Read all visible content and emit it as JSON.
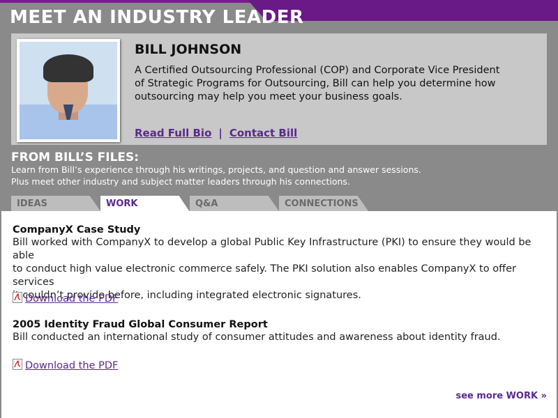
{
  "header": {
    "title": "MEET AN INDUSTRY LEADER"
  },
  "profile": {
    "name": "BILL JOHNSON",
    "bio_lines": [
      "A Certified Outsourcing Professional (COP) and Corporate Vice President",
      "of Strategic Programs for Outsourcing, Bill can help you determine how",
      "outsourcing may help you meet your business goals."
    ],
    "links": {
      "bio": "Read Full Bio",
      "separator": "|",
      "contact": "Contact Bill"
    }
  },
  "files": {
    "title": "FROM BILL’S FILES:",
    "desc_lines": [
      "Learn from Bill’s experience through his writings, projects, and question and answer sessions.",
      "Plus meet other industry and subject matter leaders through his connections."
    ]
  },
  "tabs": [
    {
      "label": "IDEAS",
      "active": false
    },
    {
      "label": "WORK",
      "active": true
    },
    {
      "label": "Q&A",
      "active": false
    },
    {
      "label": "CONNECTIONS",
      "active": false
    }
  ],
  "items": [
    {
      "title": "CompanyX Case Study",
      "body_lines": [
        "Bill worked with CompanyX to develop a global Public Key Infrastructure (PKI) to ensure they would be able",
        "to conduct high value electronic commerce safely. The PKI solution also enables CompanyX to offer services",
        "it couldn’t provide before, including integrated electronic signatures."
      ],
      "download": "Download the PDF "
    },
    {
      "title": "2005 Identity Fraud Global Consumer Report",
      "body_lines": [
        "Bill conducted an international study of consumer attitudes and awareness about identity fraud."
      ],
      "download": "Download the PDF"
    }
  ],
  "more_link": "see more WORK »",
  "colors": {
    "accent_purple": "#5a2a8a",
    "header_purple": "#6a1a86",
    "background_gray": "#8a8a8a"
  },
  "icons": {
    "pdf": "pdf-file-icon"
  }
}
